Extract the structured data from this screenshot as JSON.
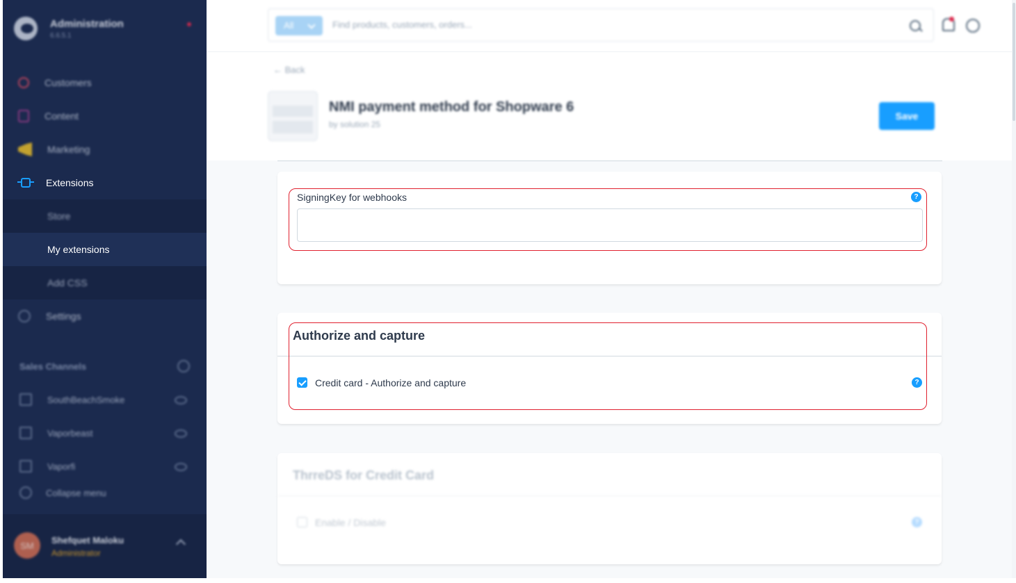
{
  "sidebar": {
    "brand": {
      "title": "Administration",
      "version": "6.6.5.1"
    },
    "nav": [
      {
        "label": "Customers",
        "icon": "customers-icon"
      },
      {
        "label": "Content",
        "icon": "content-icon"
      },
      {
        "label": "Marketing",
        "icon": "marketing-icon"
      },
      {
        "label": "Extensions",
        "icon": "extensions-icon",
        "active": true
      },
      {
        "label": "Settings",
        "icon": "settings-icon"
      }
    ],
    "extensions_sub": [
      {
        "label": "Store"
      },
      {
        "label": "My extensions",
        "current": true
      },
      {
        "label": "Add CSS"
      }
    ],
    "sales_channels": {
      "heading": "Sales Channels",
      "items": [
        {
          "label": "SouthBeachSmoke"
        },
        {
          "label": "Vaporbeast"
        },
        {
          "label": "Vaporfi"
        }
      ]
    },
    "collapse_label": "Collapse menu",
    "user": {
      "initials": "SM",
      "name": "Shefquet Maloku",
      "role": "Administrator"
    }
  },
  "topbar": {
    "search_type": "All",
    "search_placeholder": "Find products, customers, orders..."
  },
  "header": {
    "back_label": "Back",
    "title": "NMI payment method for Shopware 6",
    "vendor": "by solution 25",
    "save_label": "Save"
  },
  "cards": {
    "signing": {
      "label": "SigningKey for webhooks",
      "value": ""
    },
    "authorize": {
      "title": "Authorize and capture",
      "checkbox_label": "Credit card - Authorize and capture",
      "checked": true
    },
    "threeds": {
      "title": "ThrreDS for Credit Card",
      "checkbox_label": "Enable / Disable",
      "checked": false
    }
  },
  "colors": {
    "sidebar_bg": "#1b2a4e",
    "accent": "#189eff",
    "highlight": "#e0202e",
    "role": "#e5a72a"
  }
}
